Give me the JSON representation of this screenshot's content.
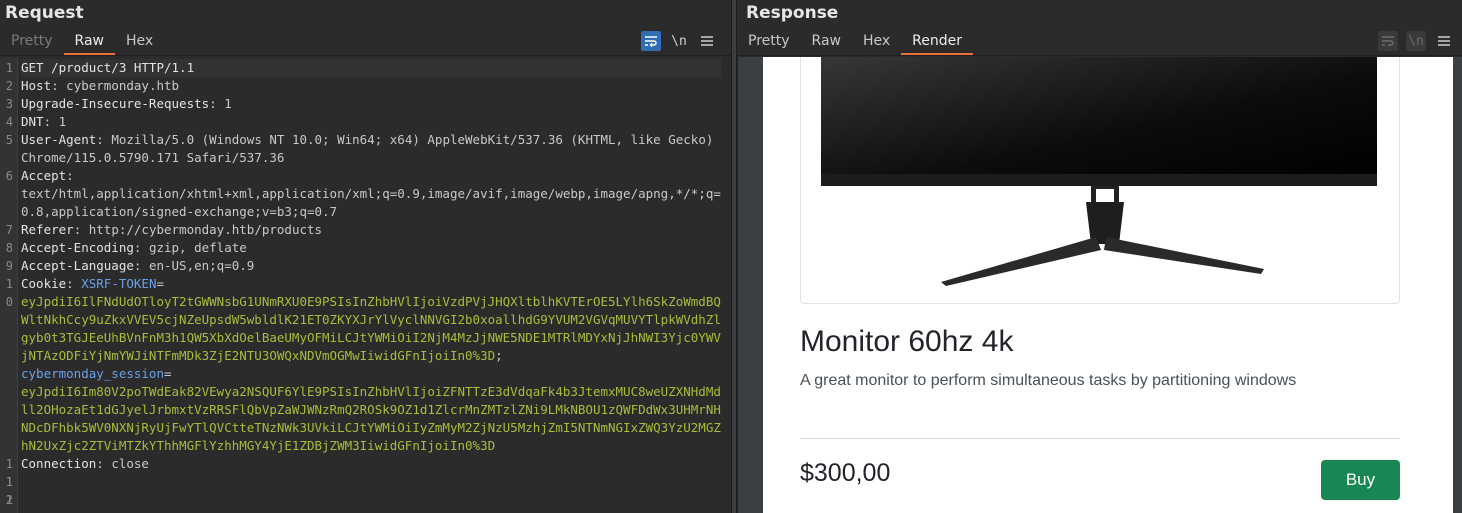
{
  "request": {
    "title": "Request",
    "tabs": [
      {
        "label": "Pretty"
      },
      {
        "label": "Raw"
      },
      {
        "label": "Hex"
      }
    ],
    "tools": {
      "wrap_icon": "wrap-icon",
      "newline_label": "\\n",
      "menu_icon": "menu-icon"
    },
    "lines": [
      {
        "n": "1",
        "key": "GET /product/3 HTTP/1.1",
        "sep": "",
        "val": ""
      },
      {
        "n": "2",
        "key": "Host",
        "sep": ": ",
        "val": "cybermonday.htb"
      },
      {
        "n": "3",
        "key": "Upgrade-Insecure-Requests",
        "sep": ": ",
        "val": "1"
      },
      {
        "n": "4",
        "key": "DNT",
        "sep": ": ",
        "val": "1"
      },
      {
        "n": "5",
        "key": "User-Agent",
        "sep": ": ",
        "val": "Mozilla/5.0 (Windows NT 10.0; Win64; x64) AppleWebKit/537.36 (KHTML, like Gecko) Chrome/115.0.5790.171 Safari/537.36"
      },
      {
        "n": "6",
        "key": "Accept",
        "sep": ":",
        "val": "text/html,application/xhtml+xml,application/xml;q=0.9,image/avif,image/webp,image/apng,*/*;q=0.8,application/signed-exchange;v=b3;q=0.7"
      },
      {
        "n": "7",
        "key": "Referer",
        "sep": ": ",
        "val": "http://cybermonday.htb/products"
      },
      {
        "n": "8",
        "key": "Accept-Encoding",
        "sep": ": ",
        "val": "gzip, deflate"
      },
      {
        "n": "9",
        "key": "Accept-Language",
        "sep": ": ",
        "val": "en-US,en;q=0.9"
      },
      {
        "n": "10",
        "key": "Cookie",
        "sep": ": ",
        "val": ""
      },
      {
        "n": "11",
        "key": "Connection",
        "sep": ": ",
        "val": "close"
      },
      {
        "n": "12",
        "key": "",
        "sep": "",
        "val": ""
      },
      {
        "n": "13",
        "key": "",
        "sep": "",
        "val": ""
      }
    ],
    "cookies": {
      "xsrf_name": "XSRF-TOKEN",
      "xsrf_value": "eyJpdiI6IlFNdUdOTloyT2tGWWNsbG1UNmRXU0E9PSIsInZhbHVlIjoiVzdPVjJHQXltblhKVTErOE5LYlh6SkZoWmdBQWltNkhCcy9uZkxVVEV5cjNZeUpsdW5wbldlK21ET0ZKYXJrYlVyclNNVGI2b0xoallhdG9YVUM2VGVqMUVYTlpkWVdhZlgyb0t3TGJEeUhBVnFnM3h1QW5XbXdOelBaeUMyOFMiLCJtYWMiOiI2NjM4MzJjNWE5NDE1MTRlMDYxNjJhNWI3Yjc0YWVjNTAzODFiYjNmYWJiNTFmMDk3ZjE2NTU3OWQxNDVmOGMwIiwidGFnIjoiIn0%3D",
      "session_name": "cybermonday_session",
      "session_value": "eyJpdiI6Im80V2poTWdEak82VEwya2NSQUF6YlE9PSIsInZhbHVlIjoiZFNTTzE3dVdqaFk4b3JtemxMUC8weUZXNHdMdll2OHozaEt1dGJyelJrbmxtVzRRSFlQbVpZaWJWNzRmQ2ROSk9OZ1d1ZlcrMnZMTzlZNi9LMkNBOU1zQWFDdWx3UHMrNHNDcDFhbk5WV0NXNjRyUjFwYTlQVCtteTNzNWk3UVkiLCJtYWMiOiIyZmMyM2ZjNzU5MzhjZmI5NTNmNGIxZWQ3YzU2MGZhN2UxZjc2ZTViMTZkYThhMGFlYzhhMGY4YjE1ZDBjZWM3IiwidGFnIjoiIn0%3D",
      "sep": "=",
      "end": ";"
    }
  },
  "response": {
    "title": "Response",
    "tabs": [
      {
        "label": "Pretty"
      },
      {
        "label": "Raw"
      },
      {
        "label": "Hex"
      },
      {
        "label": "Render"
      }
    ],
    "tools": {
      "newline_label": "\\n"
    },
    "page": {
      "product_title": "Monitor 60hz 4k",
      "product_desc": "A great monitor to perform simultaneous tasks by partitioning windows",
      "price": "$300,00",
      "buy_label": "Buy"
    }
  },
  "colors": {
    "accent_tab": "#e8703a",
    "tool_active": "#2f6db4",
    "cookie_name": "#6aa0e8",
    "cookie_value": "#a8bd3a",
    "buy_button": "#198754"
  }
}
